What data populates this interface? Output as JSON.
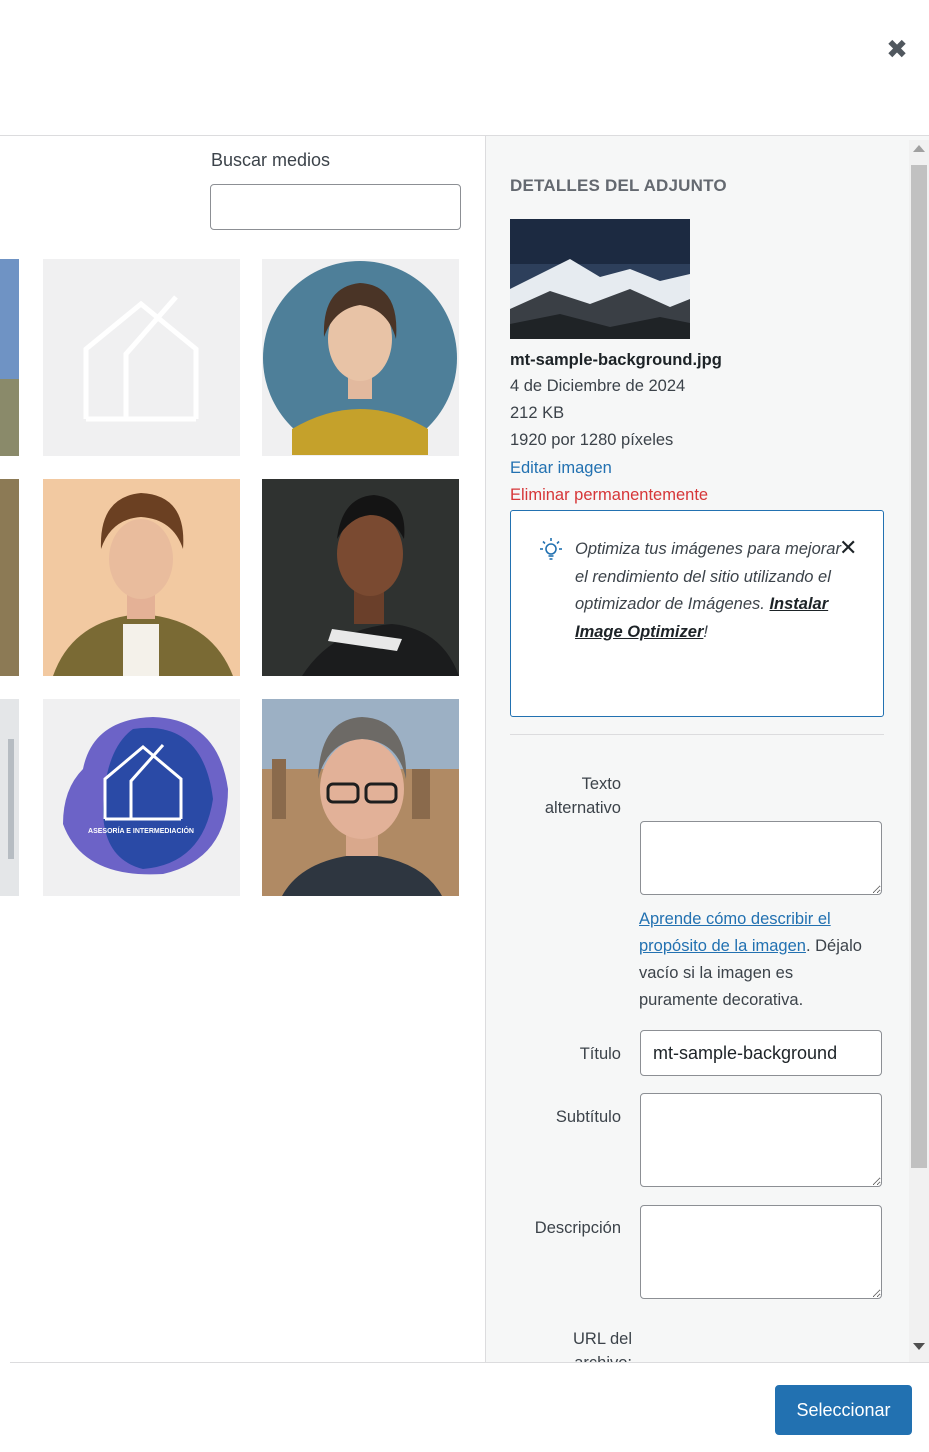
{
  "modal": {
    "close_icon": "close-icon"
  },
  "search": {
    "label": "Buscar medios",
    "value": ""
  },
  "grid": {
    "items": [
      {
        "name": "placeholder-house-logo"
      },
      {
        "name": "woman-portrait"
      },
      {
        "name": "curly-hair-man-portrait"
      },
      {
        "name": "smiling-man-portrait"
      },
      {
        "name": "asesoria-logo",
        "logo_text": "ASESORÍA E INTERMEDIACIÓN"
      },
      {
        "name": "older-man-glasses-portrait"
      }
    ]
  },
  "details": {
    "heading": "DETALLES DEL ADJUNTO",
    "filename": "mt-sample-background.jpg",
    "date": "4 de Diciembre de 2024",
    "filesize": "212 KB",
    "dimensions": "1920 por 1280 píxeles",
    "edit_link": "Editar imagen",
    "delete_link": "Eliminar permanentemente"
  },
  "notice": {
    "icon": "lightbulb-icon",
    "text_before": "Optimiza tus imágenes para mejorar el rendimiento del sitio utilizando el optimizador de Imágenes. ",
    "link_text": "Instalar Image Optimizer",
    "text_after": "!"
  },
  "fields": {
    "alt_label": "Texto alternativo",
    "alt_value": "",
    "help_link": "Aprende cómo describir el propósito de la imagen",
    "help_after_link": ".",
    "help_text": "Déjalo vacío si la imagen es puramente decorativa.",
    "title_label": "Título",
    "title_value": "mt-sample-background",
    "caption_label": "Subtítulo",
    "caption_value": "",
    "description_label": "Descripción",
    "description_value": "",
    "url_label": "URL del archivo:"
  },
  "footer": {
    "select_button": "Seleccionar"
  },
  "colors": {
    "primary": "#2271b1",
    "danger": "#d63638",
    "sidebar_bg": "#f6f7f7"
  }
}
